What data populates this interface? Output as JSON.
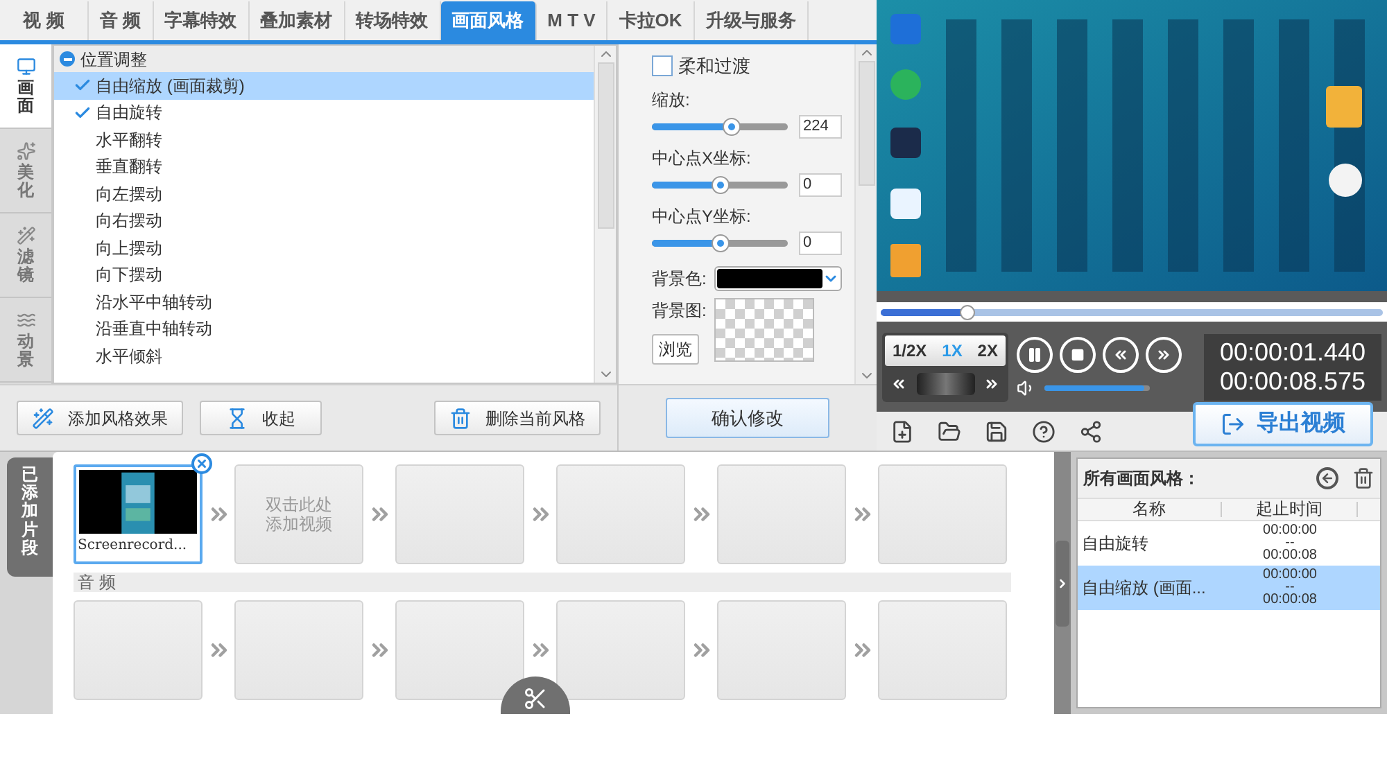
{
  "tabs": [
    {
      "label": "视 频",
      "selected": false
    },
    {
      "label": "音 频",
      "selected": false
    },
    {
      "label": "字幕特效",
      "selected": false
    },
    {
      "label": "叠加素材",
      "selected": false
    },
    {
      "label": "转场特效",
      "selected": false
    },
    {
      "label": "画面风格",
      "selected": true
    },
    {
      "label": "M T V",
      "selected": false
    },
    {
      "label": "卡拉OK",
      "selected": false
    },
    {
      "label": "升级与服务",
      "selected": false
    }
  ],
  "side_tabs": [
    {
      "label": "画面",
      "selected": true
    },
    {
      "label": "美化",
      "selected": false
    },
    {
      "label": "滤镜",
      "selected": false
    },
    {
      "label": "动景",
      "selected": false
    }
  ],
  "style_list": {
    "group": "位置调整",
    "expanded": true,
    "items": [
      {
        "label": "自由缩放 (画面裁剪)",
        "checked": true,
        "selected": true
      },
      {
        "label": "自由旋转",
        "checked": true,
        "selected": false
      },
      {
        "label": "水平翻转",
        "checked": false,
        "selected": false
      },
      {
        "label": "垂直翻转",
        "checked": false,
        "selected": false
      },
      {
        "label": "向左摆动",
        "checked": false,
        "selected": false
      },
      {
        "label": "向右摆动",
        "checked": false,
        "selected": false
      },
      {
        "label": "向上摆动",
        "checked": false,
        "selected": false
      },
      {
        "label": "向下摆动",
        "checked": false,
        "selected": false
      },
      {
        "label": "沿水平中轴转动",
        "checked": false,
        "selected": false
      },
      {
        "label": "沿垂直中轴转动",
        "checked": false,
        "selected": false
      },
      {
        "label": "水平倾斜",
        "checked": false,
        "selected": false
      }
    ]
  },
  "list_buttons": [
    {
      "kind": "add",
      "label": "添加风格效果"
    },
    {
      "kind": "collapse",
      "label": "收起"
    },
    {
      "kind": "delete",
      "label": "删除当前风格"
    }
  ],
  "settings": {
    "smooth": {
      "label": "柔和过渡",
      "checked": false
    },
    "sliders": [
      {
        "label": "缩放:",
        "level": 0.58,
        "value": "224"
      },
      {
        "label": "中心点X坐标:",
        "level": 0.5,
        "value": "0"
      },
      {
        "label": "中心点Y坐标:",
        "level": 0.5,
        "value": "0"
      }
    ],
    "bg_color_label": "背景色:",
    "bg_image_label": "背景图:",
    "browse": "浏览",
    "confirm": "确认修改"
  },
  "player": {
    "progress": {
      "level": 0.17
    },
    "speeds": [
      {
        "label": "1/2X",
        "selected": false
      },
      {
        "label": "1X",
        "selected": true
      },
      {
        "label": "2X",
        "selected": false
      }
    ],
    "current_time": "00:00:01.440",
    "total_time": "00:00:08.575",
    "volume": {
      "level": 0.95
    },
    "export": "导出视频"
  },
  "timeline": {
    "label": "已添加片段",
    "video_clips": [
      {
        "kind": "clip",
        "name": "Screenrecord..."
      },
      {
        "kind": "add",
        "hint": "双击此处添加视频"
      },
      {
        "kind": "empty"
      },
      {
        "kind": "empty"
      },
      {
        "kind": "empty"
      },
      {
        "kind": "empty"
      }
    ],
    "audio_label": "音 频",
    "audio_slots": [
      {
        "kind": "empty"
      },
      {
        "kind": "empty"
      },
      {
        "kind": "empty"
      },
      {
        "kind": "empty"
      },
      {
        "kind": "empty"
      },
      {
        "kind": "empty"
      }
    ]
  },
  "styles_panel": {
    "title": "所有画面风格：",
    "columns": [
      "名称",
      "起止时间"
    ],
    "rows": [
      {
        "name": "自由旋转",
        "start": "00:00:00",
        "sep": "--",
        "end": "00:00:08",
        "selected": false
      },
      {
        "name": "自由缩放 (画面...",
        "start": "00:00:00",
        "sep": "--",
        "end": "00:00:08",
        "selected": true
      }
    ]
  }
}
